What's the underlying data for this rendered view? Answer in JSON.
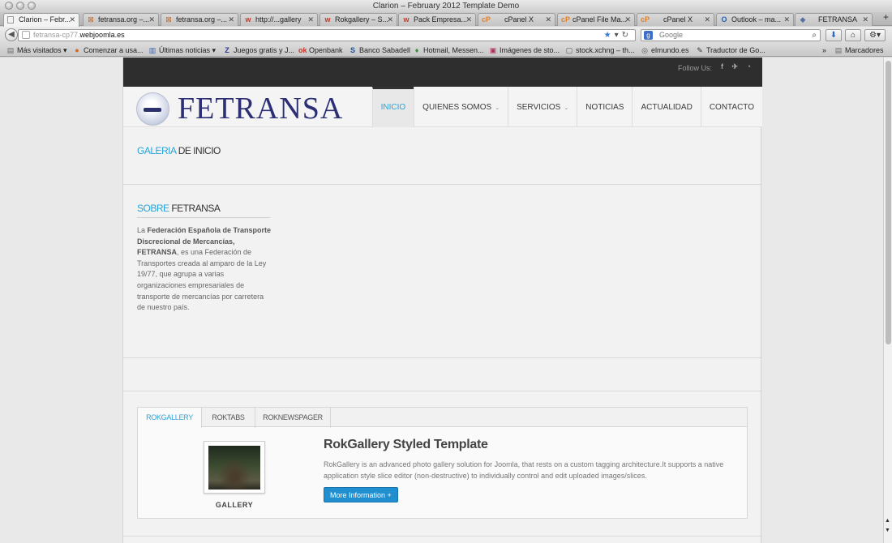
{
  "window": {
    "title": "Clarion – February 2012 Template Demo"
  },
  "tabs": [
    {
      "label": "Clarion – Febr...",
      "icon": "page-icon",
      "active": true
    },
    {
      "label": "fetransa.org –...",
      "icon": "fetransa-icon"
    },
    {
      "label": "fetransa.org –...",
      "icon": "fetransa-icon"
    },
    {
      "label": "http://...gallery",
      "icon": "rockettheme-icon"
    },
    {
      "label": "Rokgallery – S...",
      "icon": "rockettheme-icon"
    },
    {
      "label": "Pack Empresa...",
      "icon": "rockettheme-icon"
    },
    {
      "label": "cPanel X",
      "icon": "cpanel-icon"
    },
    {
      "label": "cPanel File Ma...",
      "icon": "cpanel-icon"
    },
    {
      "label": "cPanel X",
      "icon": "cpanel-icon"
    },
    {
      "label": "Outlook – ma...",
      "icon": "outlook-icon"
    },
    {
      "label": "FETRANSA",
      "icon": "joomla-icon"
    }
  ],
  "address_bar": {
    "prefix": "fetransa-cp77.",
    "host": "webjoomla.es"
  },
  "search_bar": {
    "placeholder": "Google"
  },
  "bookmarks": [
    {
      "label": "Más visitados ▾",
      "icon": "folder-icon"
    },
    {
      "label": "Comenzar a usa...",
      "icon": "firefox-icon"
    },
    {
      "label": "Últimas noticias ▾",
      "icon": "rss-icon"
    },
    {
      "label": "Juegos gratis y J...",
      "icon": "games-icon"
    },
    {
      "label": "Openbank",
      "icon": "openbank-icon"
    },
    {
      "label": "Banco Sabadell",
      "icon": "sabadell-icon"
    },
    {
      "label": "Hotmail, Messen...",
      "icon": "msn-icon"
    },
    {
      "label": "Imágenes de sto...",
      "icon": "image-icon"
    },
    {
      "label": "stock.xchng – th...",
      "icon": "stock-icon"
    },
    {
      "label": "elmundo.es",
      "icon": "news-icon"
    },
    {
      "label": "Traductor de Go...",
      "icon": "translate-icon"
    }
  ],
  "bookmarks_folder": "Marcadores",
  "site": {
    "follow_label": "Follow Us:",
    "social": {
      "facebook": "f",
      "twitter": "t",
      "rss": "rss"
    },
    "logo_text": "FETRANSA",
    "menu": [
      {
        "label": "INICIO",
        "active": true
      },
      {
        "label": "QUIENES SOMOS",
        "dropdown": true
      },
      {
        "label": "SERVICIOS",
        "dropdown": true
      },
      {
        "label": "NOTICIAS"
      },
      {
        "label": "ACTUALIDAD"
      },
      {
        "label": "CONTACTO"
      }
    ],
    "gallery_heading": {
      "accent": "GALERIA",
      "rest": " DE INICIO"
    },
    "about_heading": {
      "accent": "SOBRE",
      "rest": " FETRANSA"
    },
    "about": {
      "lead": "La ",
      "bold": "Federación Española de Transporte Discrecional de Mercancías, FETRANSA",
      "text": ", es una Federación de Transportes creada al amparo de la Ley 19/77, que agrupa a varias organizaciones empresariales de transporte de mercancías por carretera de nuestro país."
    },
    "tabbed": {
      "tabs": [
        "ROKGALLERY",
        "ROKTABS",
        "ROKNEWSPAGER"
      ],
      "active_tab": 0,
      "thumb_caption": "GALLERY",
      "title": "RokGallery Styled Template",
      "description": "RokGallery is an advanced photo gallery solution for Joomla, that rests on a custom tagging architecture.It supports a native application style slice editor (non-destructive) to individually control and edit uploaded images/slices.",
      "button": "More Information"
    }
  },
  "colors": {
    "accent": "#29a3d6",
    "logo": "#2c2f74",
    "button": "#1f8fd0",
    "topbar": "#2e2e2e"
  }
}
